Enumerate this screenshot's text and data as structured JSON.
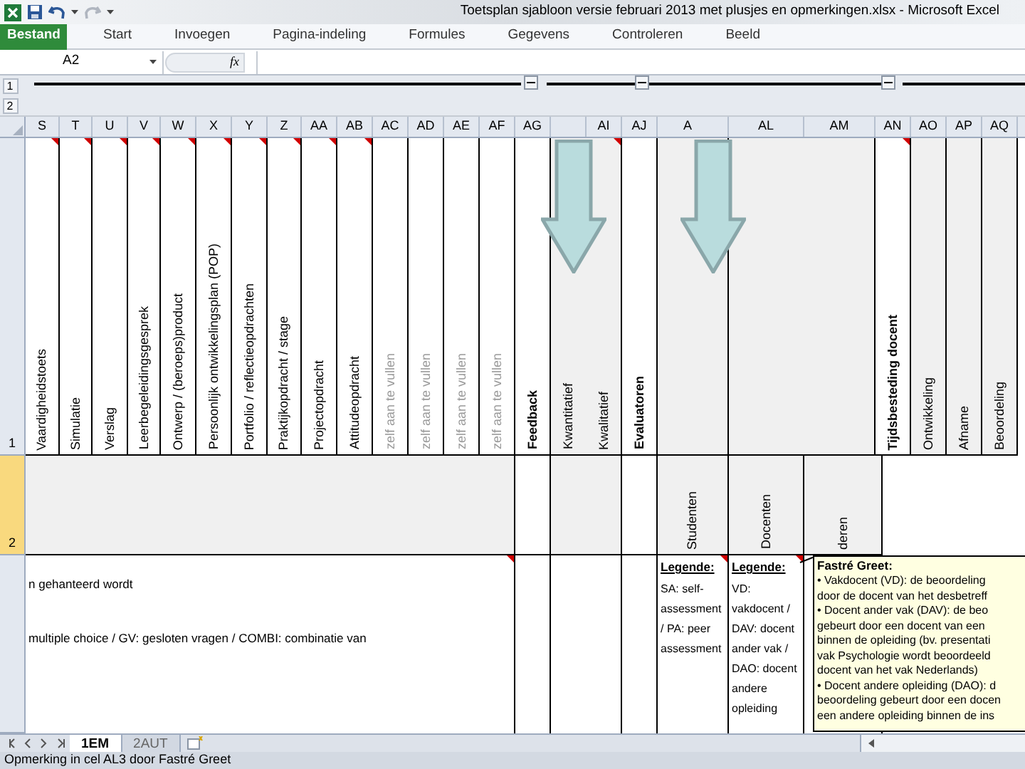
{
  "window": {
    "title": "Toetsplan sjabloon versie februari 2013 met plusjes en opmerkingen.xlsx - Microsoft Excel"
  },
  "quick_access": [
    {
      "kind": "save",
      "disabled": false
    },
    {
      "kind": "undo",
      "disabled": false
    },
    {
      "kind": "redo",
      "disabled": true
    }
  ],
  "ribbon_tabs": [
    {
      "label": "Bestand",
      "selected": true
    },
    {
      "label": "Start",
      "selected": false
    },
    {
      "label": "Invoegen",
      "selected": false
    },
    {
      "label": "Pagina-indeling",
      "selected": false
    },
    {
      "label": "Formules",
      "selected": false
    },
    {
      "label": "Gegevens",
      "selected": false
    },
    {
      "label": "Controleren",
      "selected": false
    },
    {
      "label": "Beeld",
      "selected": false
    }
  ],
  "formula_bar": {
    "name_box": "A2",
    "fx": "fx"
  },
  "outline": {
    "levels": [
      "1",
      "2"
    ],
    "groups": [
      {
        "expanded": true
      },
      {
        "expanded": true
      },
      {
        "expanded": true
      }
    ]
  },
  "columns": [
    {
      "label": "S"
    },
    {
      "label": "T"
    },
    {
      "label": "U"
    },
    {
      "label": "V"
    },
    {
      "label": "W"
    },
    {
      "label": "X"
    },
    {
      "label": "Y"
    },
    {
      "label": "Z"
    },
    {
      "label": "AA"
    },
    {
      "label": "AB"
    },
    {
      "label": "AC"
    },
    {
      "label": "AD"
    },
    {
      "label": "AE"
    },
    {
      "label": "AF"
    },
    {
      "label": "AG"
    },
    {},
    {
      "label": "AI"
    },
    {
      "label": "AJ"
    },
    {
      "label": "A"
    },
    {
      "label": "AL"
    },
    {
      "label": "AM"
    },
    {
      "label": "AN"
    },
    {
      "label": "AO"
    },
    {
      "label": "AP"
    },
    {
      "label": "AQ"
    }
  ],
  "rows": [
    {
      "kind": "headings",
      "header": "1",
      "selected": false,
      "cells": [
        {
          "text": "Vaardigheidstoets",
          "comment": true,
          "bold": false,
          "muted": false,
          "shaded": false
        },
        {
          "text": "Simulatie",
          "comment": true,
          "bold": false,
          "muted": false,
          "shaded": false
        },
        {
          "text": "Verslag",
          "comment": true,
          "bold": false,
          "muted": false,
          "shaded": false
        },
        {
          "text": "Leerbegeleidingsgesprek",
          "comment": true,
          "bold": false,
          "muted": false,
          "shaded": false
        },
        {
          "text": "Ontwerp / (beroeps)product",
          "comment": true,
          "bold": false,
          "muted": false,
          "shaded": false
        },
        {
          "text": "Persoonlijk ontwikkelingsplan (POP)",
          "comment": true,
          "bold": false,
          "muted": false,
          "shaded": false
        },
        {
          "text": "Portfolio / reflectieopdrachten",
          "comment": true,
          "bold": false,
          "muted": false,
          "shaded": false
        },
        {
          "text": "Praktijkopdracht / stage",
          "comment": true,
          "bold": false,
          "muted": false,
          "shaded": false
        },
        {
          "text": "Projectopdracht",
          "comment": true,
          "bold": false,
          "muted": false,
          "shaded": false
        },
        {
          "text": "Attitudeopdracht",
          "comment": true,
          "bold": false,
          "muted": false,
          "shaded": false
        },
        {
          "text": "zelf aan te vullen",
          "comment": false,
          "bold": false,
          "muted": true,
          "shaded": false
        },
        {
          "text": "zelf aan te vullen",
          "comment": false,
          "bold": false,
          "muted": true,
          "shaded": false
        },
        {
          "text": "zelf aan te vullen",
          "comment": false,
          "bold": false,
          "muted": true,
          "shaded": false
        },
        {
          "text": "zelf aan te vullen",
          "comment": false,
          "bold": false,
          "muted": true,
          "shaded": false
        },
        {
          "text": "Feedback",
          "comment": false,
          "bold": true,
          "muted": false,
          "shaded": false
        },
        {
          "text": "Kwantitatief",
          "comment": false,
          "bold": false,
          "muted": false,
          "shaded": true
        },
        {
          "text": "Kwalitatief",
          "comment": true,
          "bold": false,
          "muted": false,
          "shaded": true
        },
        {
          "text": "Evaluatoren",
          "comment": false,
          "bold": true,
          "muted": false,
          "shaded": false
        },
        {
          "comment": false,
          "shaded": true
        },
        {
          "comment": false,
          "shaded": true
        },
        {
          "comment": false,
          "shaded": true
        },
        {
          "text": "Tijdsbesteding docent",
          "comment": true,
          "bold": true,
          "muted": false,
          "shaded": false
        },
        {
          "text": "Ontwikkeling",
          "comment": false,
          "bold": false,
          "muted": false,
          "shaded": true
        },
        {
          "text": "Afname",
          "comment": false,
          "bold": false,
          "muted": false,
          "shaded": true
        },
        {
          "text": "Beoordeling",
          "comment": false,
          "bold": false,
          "muted": false,
          "shaded": true
        }
      ]
    },
    {
      "kind": "subheadings",
      "header": "2",
      "selected": true,
      "cells": [
        {
          "shaded": true
        },
        {
          "shaded": false
        },
        {
          "shaded": true
        },
        {
          "shaded": false
        },
        {
          "text": "Studenten",
          "shaded": true
        },
        {
          "text": "Docenten",
          "shaded": true
        },
        {
          "text": "deren",
          "shaded": true
        }
      ]
    },
    {
      "kind": "content",
      "selected": false,
      "cells": [
        {
          "lines": [
            "n gehanteerd wordt",
            "multiple  choice / GV: gesloten vragen / COMBI: combinatie  van"
          ],
          "comment": true
        },
        {
          "comment": false
        },
        {
          "comment": false
        },
        {
          "comment": false
        },
        {
          "title": "Legende:",
          "text": "SA: self-assessment / PA: peer assessment",
          "comment": true
        },
        {
          "title": "Legende:",
          "text": "VD: vakdocent / DAV: docent ander vak / DAO: docent andere opleiding",
          "comment": true
        },
        {}
      ]
    }
  ],
  "comment": {
    "author": "Fastré Greet:",
    "lines": [
      "• Vakdocent (VD): de beoordeling",
      "door de docent van het desbetreff",
      "• Docent ander vak (DAV): de beo",
      "gebeurt door een docent van een",
      "binnen de opleiding (bv. presentati",
      "vak Psychologie wordt beoordeeld",
      "docent van het vak Nederlands)",
      "• Docent andere opleiding (DAO): d",
      "beoordeling gebeurt door een docen",
      "een andere opleiding binnen de ins"
    ]
  },
  "sheet_tabs": [
    {
      "label": "1EM",
      "selected": true
    },
    {
      "label": "2AUT",
      "selected": false
    }
  ],
  "status_bar": {
    "text": "Opmerking in cel AL3 door Fastré Greet"
  }
}
